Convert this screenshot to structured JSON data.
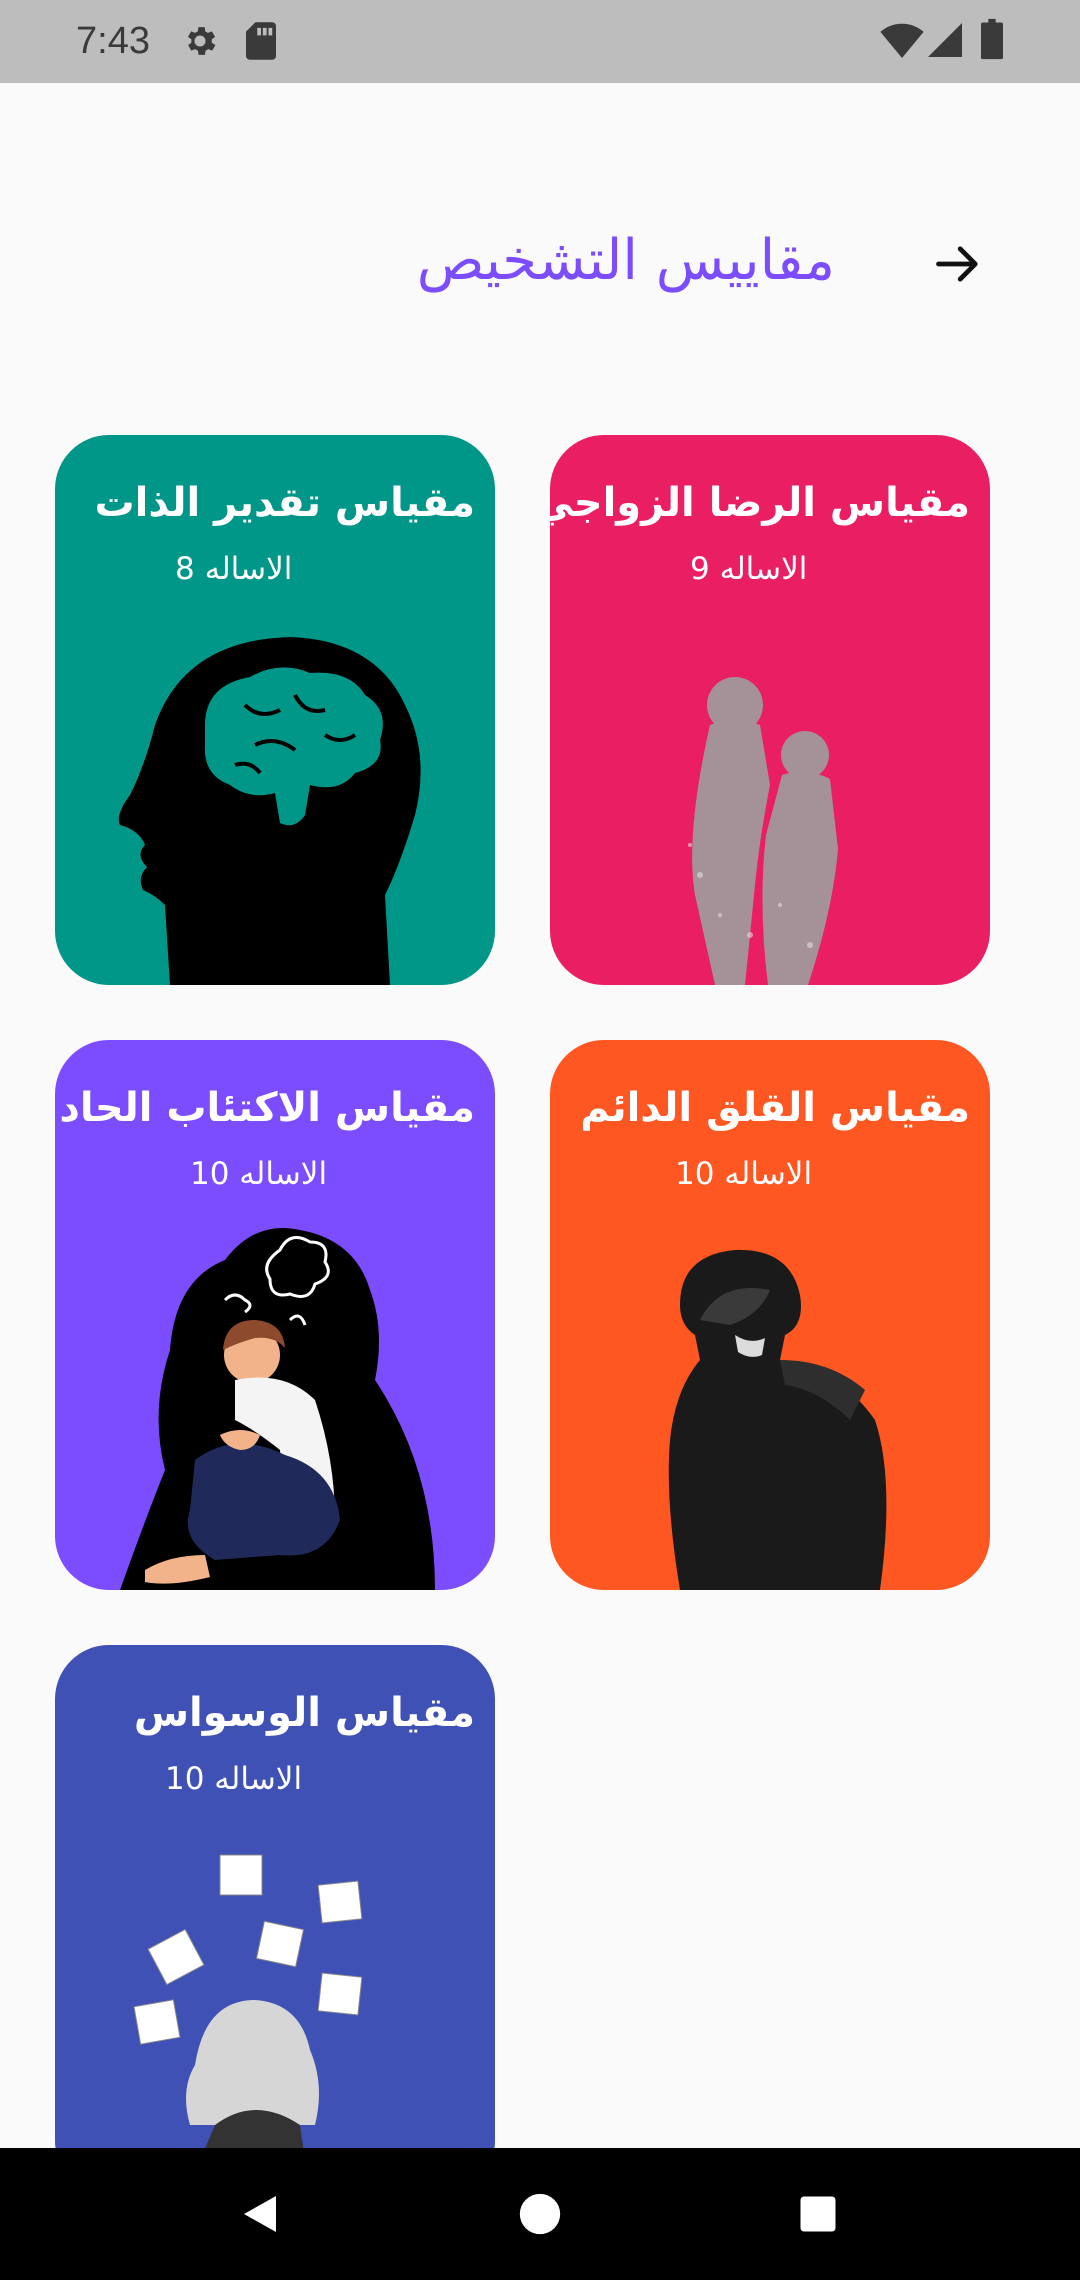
{
  "status_bar": {
    "time": "7:43",
    "icons": [
      "gear-icon",
      "sd-card-icon",
      "wifi-icon",
      "signal-icon",
      "battery-icon"
    ]
  },
  "header": {
    "title": "مقاييس التشخيص",
    "back_icon": "arrow-right-icon",
    "title_color": "#7c4dff"
  },
  "cards": [
    {
      "title": "مقياس الرضا الزواجي",
      "count": "الاساله 9",
      "color": "#e91e63",
      "art": "couple-silhouette"
    },
    {
      "title": "مقياس تقدير الذات",
      "count": "الاساله 8",
      "color": "#009688",
      "art": "head-brain"
    },
    {
      "title": "مقياس القلق الدائم",
      "count": "الاساله 10",
      "color": "#ff5722",
      "art": "hooded-boy"
    },
    {
      "title": "مقياس الاكتئاب الحاد",
      "count": "الاساله 10",
      "color": "#7c4dff",
      "art": "sad-person-shadow"
    },
    {
      "title": "مقياس الوسواس",
      "count": "الاساله 10",
      "color": "#3f51b5",
      "art": "person-with-notes"
    }
  ],
  "nav_bar": {
    "icons": [
      "back-triangle-icon",
      "home-circle-icon",
      "recents-square-icon"
    ]
  }
}
